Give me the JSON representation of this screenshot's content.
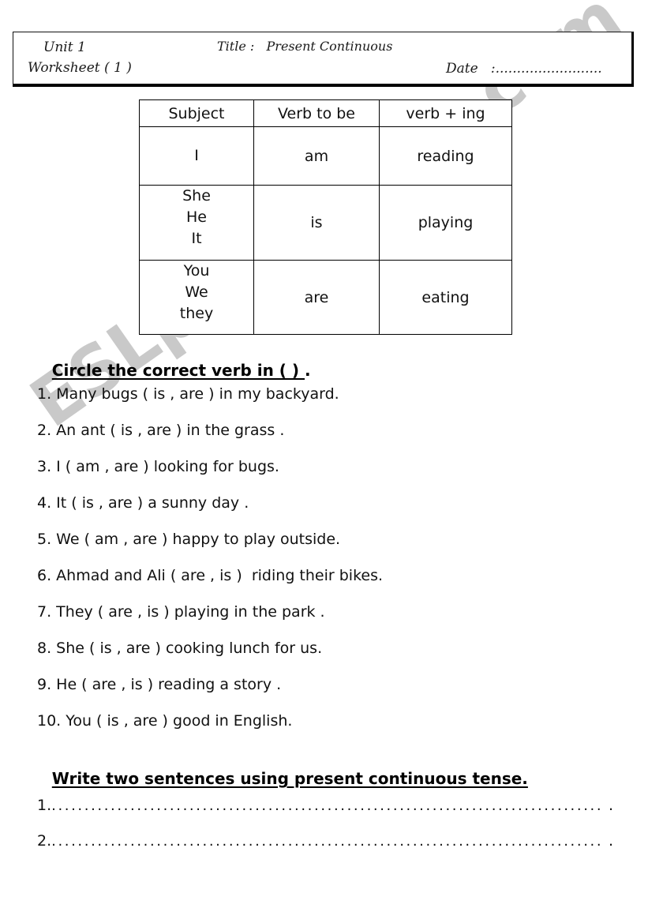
{
  "header": {
    "unit": "Unit 1",
    "worksheet": "Worksheet ( 1 )",
    "title": "Title :   Present Continuous",
    "date": "Date   :........................."
  },
  "watermark": {
    "text": "ESLprintables.com",
    "color": "#c9c9c9"
  },
  "conjugation_table": {
    "columns": [
      "Subject",
      "Verb to be",
      "verb + ing"
    ],
    "rows": [
      {
        "subjects": [
          "I"
        ],
        "verb_to_be": "am",
        "verb_ing": "reading"
      },
      {
        "subjects": [
          "She",
          "He",
          "It"
        ],
        "verb_to_be": "is",
        "verb_ing": "playing"
      },
      {
        "subjects": [
          "You",
          "We",
          "they"
        ],
        "verb_to_be": "are",
        "verb_ing": "eating"
      }
    ]
  },
  "exercise_1": {
    "heading_underlined": "Circle the correct verb in ( ) ",
    "heading_tail": ".",
    "questions": [
      "1. Many bugs ( is , are ) in my backyard.",
      "2. An ant ( is , are ) in the grass .",
      "3. I ( am , are ) looking for bugs.",
      "4. It ( is , are ) a sunny day .",
      "5. We ( am , are ) happy to play outside.",
      "6. Ahmad and Ali ( are , is )  riding their bikes.",
      "7. They ( are , is ) playing in the park .",
      "8. She ( is , are ) cooking lunch for us.",
      "9. He ( are , is ) reading a story .",
      "10. You ( is , are ) good in English."
    ]
  },
  "exercise_2": {
    "heading": "Write two sentences using present continuous tense.",
    "answer_lines": [
      {
        "number": "1.",
        "dots": "...........................................................................................................",
        "end": "."
      },
      {
        "number": "2.",
        "dots": "............................................................................................................",
        "end": "."
      }
    ]
  }
}
